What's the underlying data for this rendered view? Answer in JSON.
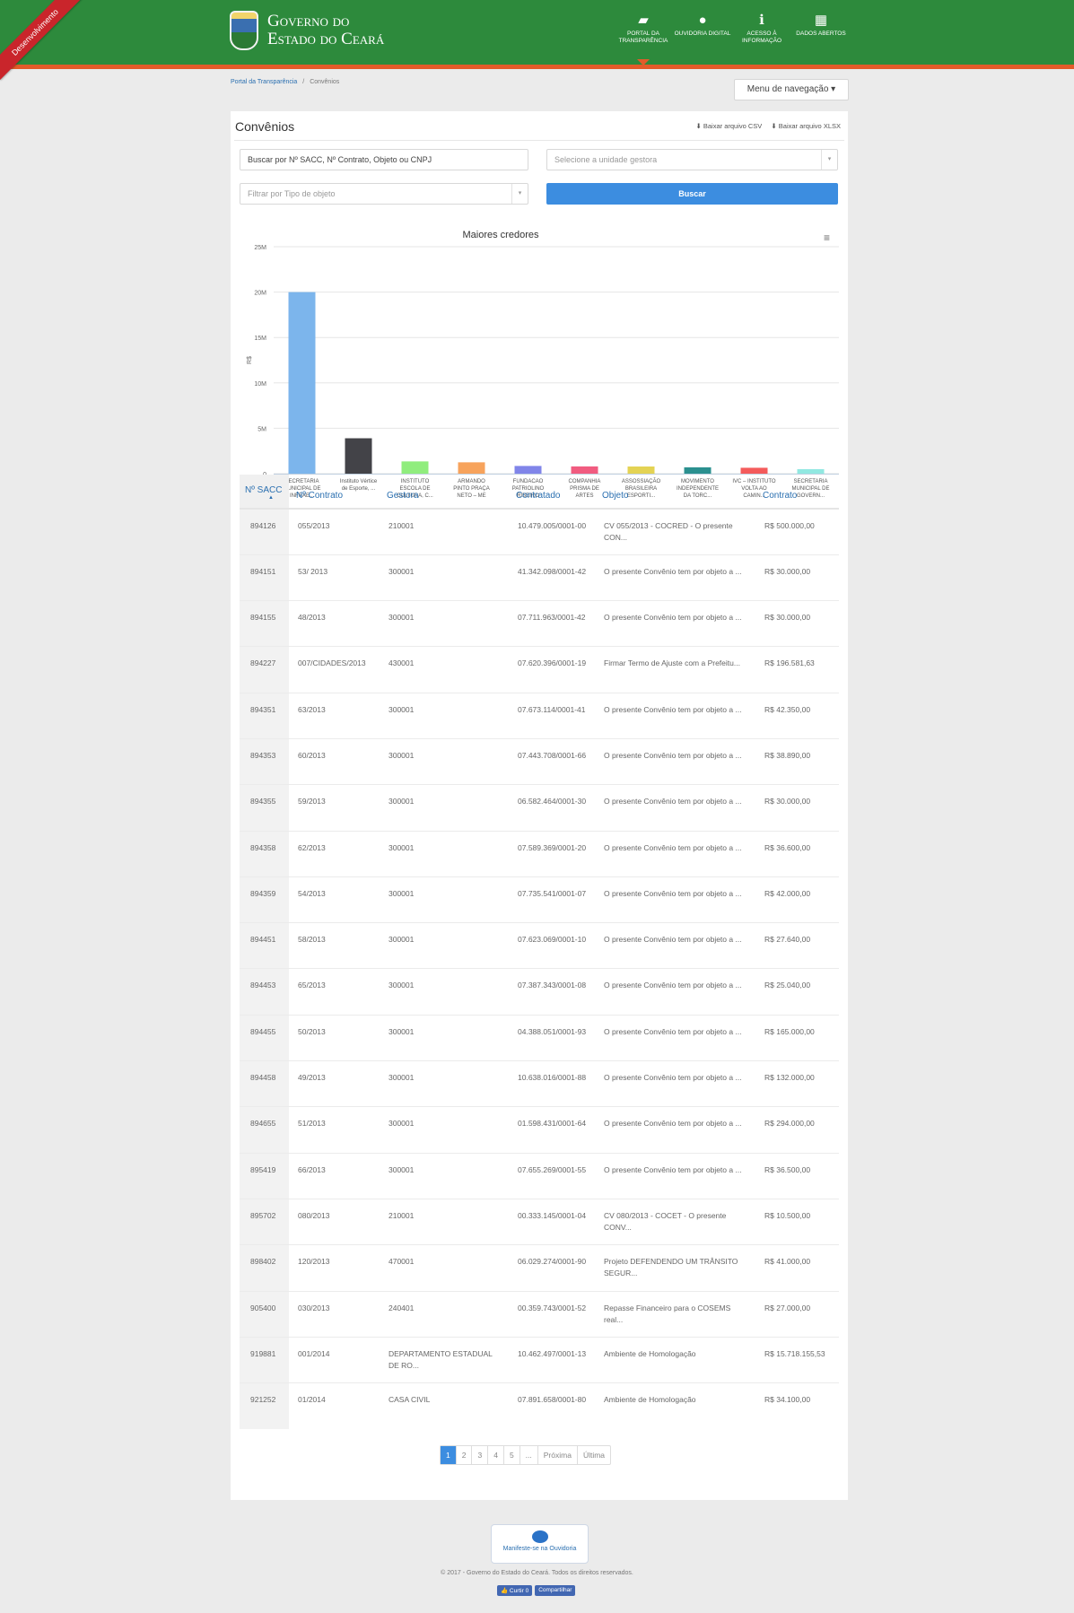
{
  "ribbon": "Desenvolvimento",
  "header": {
    "logo_line1": "Governo do",
    "logo_line2": "Estado do Ceará",
    "nav": [
      {
        "icon": "folder-open-icon",
        "glyph": "▰",
        "label": "Portal da Transparência"
      },
      {
        "icon": "comment-icon",
        "glyph": "●",
        "label": "Ouvidoria Digital"
      },
      {
        "icon": "info-icon",
        "glyph": "ℹ",
        "label": "Acesso à Informação"
      },
      {
        "icon": "table-icon",
        "glyph": "▦",
        "label": "Dados Abertos"
      }
    ]
  },
  "breadcrumb": {
    "home": "Portal da Transparência",
    "sep": "/",
    "current": "Convênios"
  },
  "menu_button": "Menu de navegação ▾",
  "page_title": "Convênios",
  "downloads": {
    "csv": "⬇ Baixar arquivo CSV",
    "xlsx": "⬇ Baixar arquivo XLSX"
  },
  "filters": {
    "search_value": "Buscar por Nº SACC, Nº Contrato, Objeto ou CNPJ",
    "unidade_placeholder": "Selecione a unidade gestora",
    "tipo_placeholder": "Filtrar por Tipo de objeto",
    "search_button": "Buscar"
  },
  "chart_data": {
    "type": "bar",
    "title": "Maiores credores",
    "ylabel": "R$",
    "ylim": [
      0,
      25000000
    ],
    "ytick_labels": [
      "0",
      "5M",
      "10M",
      "15M",
      "20M",
      "25M"
    ],
    "categories": [
      [
        "SECRETARIA",
        "MUNICIPAL DE",
        "INFRAE..."
      ],
      [
        "Instituto Vértice",
        "de Esporte, ..."
      ],
      [
        "INSTITUTO",
        "ESCOLA DE",
        "CULTURA, C..."
      ],
      [
        "ARMANDO",
        "PINTO PRAÇA",
        "NETO – ME"
      ],
      [
        "FUNDACAO",
        "PATRIOLINO",
        "RIBEIRO"
      ],
      [
        "COMPANHIA",
        "PRISMA DE",
        "ARTES"
      ],
      [
        "ASSOSSIAÇÃO",
        "BRASILEIRA",
        "ESPORTI..."
      ],
      [
        "MOVIMENTO",
        "INDEPENDENTE",
        "DA TORC..."
      ],
      [
        "IVC – INSTITUTO",
        "VOLTA AO",
        "CAMIN..."
      ],
      [
        "SECRETARIA",
        "MUNICIPAL DE",
        "GOVERN..."
      ]
    ],
    "values": [
      20000000,
      3900000,
      1350000,
      1250000,
      850000,
      800000,
      790000,
      700000,
      650000,
      500000
    ],
    "colors": [
      "#7cb5ec",
      "#434348",
      "#90ed7d",
      "#f7a35c",
      "#8085e9",
      "#f15c80",
      "#e4d354",
      "#2b908f",
      "#f45b5b",
      "#91e8e1"
    ],
    "menu_icon": "hamburger-icon"
  },
  "table": {
    "headers": [
      "Nº SACC",
      "Nº Contrato",
      "Gestora",
      "Contratado",
      "Objeto",
      "Contrato"
    ],
    "sort_arrow": "▲",
    "rows": [
      [
        "894126",
        "055/2013",
        "210001",
        "10.479.005/0001-00",
        "CV 055/2013 - COCRED - O presente CON...",
        "R$ 500.000,00"
      ],
      [
        "894151",
        "53/ 2013",
        "300001",
        "41.342.098/0001-42",
        "O presente Convênio tem por objeto a ...",
        "R$ 30.000,00"
      ],
      [
        "894155",
        "48/2013",
        "300001",
        "07.711.963/0001-42",
        "O presente Convênio tem por objeto a ...",
        "R$ 30.000,00"
      ],
      [
        "894227",
        "007/CIDADES/2013",
        "430001",
        "07.620.396/0001-19",
        "Firmar Termo de Ajuste com a Prefeitu...",
        "R$ 196.581,63"
      ],
      [
        "894351",
        "63/2013",
        "300001",
        "07.673.114/0001-41",
        "O presente Convênio tem por objeto a ...",
        "R$ 42.350,00"
      ],
      [
        "894353",
        "60/2013",
        "300001",
        "07.443.708/0001-66",
        "O presente Convênio tem por objeto a ...",
        "R$ 38.890,00"
      ],
      [
        "894355",
        "59/2013",
        "300001",
        "06.582.464/0001-30",
        "O presente Convênio tem por objeto a ...",
        "R$ 30.000,00"
      ],
      [
        "894358",
        "62/2013",
        "300001",
        "07.589.369/0001-20",
        "O presente Convênio tem por objeto a ...",
        "R$ 36.600,00"
      ],
      [
        "894359",
        "54/2013",
        "300001",
        "07.735.541/0001-07",
        "O presente Convênio tem por objeto a ...",
        "R$ 42.000,00"
      ],
      [
        "894451",
        "58/2013",
        "300001",
        "07.623.069/0001-10",
        "O presente Convênio tem por objeto a ...",
        "R$ 27.640,00"
      ],
      [
        "894453",
        "65/2013",
        "300001",
        "07.387.343/0001-08",
        "O presente Convênio tem por objeto a ...",
        "R$ 25.040,00"
      ],
      [
        "894455",
        "50/2013",
        "300001",
        "04.388.051/0001-93",
        "O presente Convênio tem por objeto a ...",
        "R$ 165.000,00"
      ],
      [
        "894458",
        "49/2013",
        "300001",
        "10.638.016/0001-88",
        "O presente Convênio tem por objeto a ...",
        "R$ 132.000,00"
      ],
      [
        "894655",
        "51/2013",
        "300001",
        "01.598.431/0001-64",
        "O presente Convênio tem por objeto a ...",
        "R$ 294.000,00"
      ],
      [
        "895419",
        "66/2013",
        "300001",
        "07.655.269/0001-55",
        "O presente Convênio tem por objeto a ...",
        "R$ 36.500,00"
      ],
      [
        "895702",
        "080/2013",
        "210001",
        "00.333.145/0001-04",
        "CV 080/2013 - COCET - O presente CONV...",
        "R$ 10.500,00"
      ],
      [
        "898402",
        "120/2013",
        "470001",
        "06.029.274/0001-90",
        "Projeto DEFENDENDO UM TRÂNSITO SEGUR...",
        "R$ 41.000,00"
      ],
      [
        "905400",
        "030/2013",
        "240401",
        "00.359.743/0001-52",
        "Repasse Financeiro para o COSEMS real...",
        "R$ 27.000,00"
      ],
      [
        "919881",
        "001/2014",
        "DEPARTAMENTO ESTADUAL DE RO...",
        "10.462.497/0001-13",
        "Ambiente de Homologação",
        "R$ 15.718.155,53"
      ],
      [
        "921252",
        "01/2014",
        "CASA CIVIL",
        "07.891.658/0001-80",
        "Ambiente de Homologação",
        "R$ 34.100,00"
      ]
    ]
  },
  "pagination": {
    "pages": [
      "1",
      "2",
      "3",
      "4",
      "5",
      "..."
    ],
    "next": "Próxima",
    "last": "Última",
    "current": "1"
  },
  "footer": {
    "ouvidoria": "Manifeste-se na Ouvidoria",
    "copyright": "© 2017 - Governo do Estado do Ceará. Todos os direitos reservados.",
    "like": "👍 Curtir 0",
    "share": "Compartilhar"
  }
}
